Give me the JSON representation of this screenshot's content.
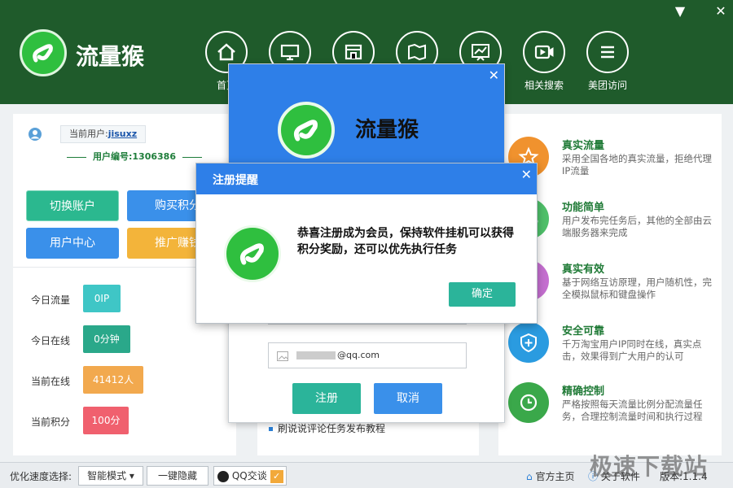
{
  "app": {
    "title": "流量猴"
  },
  "nav": [
    {
      "label": "首页",
      "icon": "home-icon"
    },
    {
      "label": "",
      "icon": "monitor-icon"
    },
    {
      "label": "",
      "icon": "store-icon"
    },
    {
      "label": "",
      "icon": "map-icon"
    },
    {
      "label": "",
      "icon": "chart-icon"
    },
    {
      "label": "相关搜索",
      "icon": "video-icon"
    },
    {
      "label": "美团访问",
      "icon": "menu-icon"
    }
  ],
  "user": {
    "label": "当前用户:",
    "name": "jisuxz",
    "id_text": "用户编号:1306386"
  },
  "buttons": {
    "switch_account": "切换账户",
    "buy_points": "购买积分",
    "user_center": "用户中心",
    "promote": "推广赚钱"
  },
  "stats": [
    {
      "label": "今日流量",
      "value": "0IP",
      "color": "#3fc6c6"
    },
    {
      "label": "今日在线",
      "value": "0分钟",
      "color": "#2aa88a"
    },
    {
      "label": "当前在线",
      "value": "41412人",
      "color": "#f2a94e"
    },
    {
      "label": "当前积分",
      "value": "100分",
      "color": "#f0606e"
    }
  ],
  "center": {
    "link": "刷说说评论任务发布教程"
  },
  "features": [
    {
      "title": "真实流量",
      "desc": "采用全国各地的真实流量，拒绝代理IP流量",
      "color": "#f0922e"
    },
    {
      "title": "功能简单",
      "desc": "用户发布完任务后，其他的全部由云端服务器来完成",
      "color": "#4fc06a"
    },
    {
      "title": "真实有效",
      "desc": "基于网络互访原理，用户随机性，完全模拟鼠标和键盘操作",
      "color": "#c56fd0"
    },
    {
      "title": "安全可靠",
      "desc": "千万淘宝用户IP同时在线，真实点击，效果得到广大用户的认可",
      "color": "#2a9be0"
    },
    {
      "title": "精确控制",
      "desc": "严格按照每天流量比例分配流量任务，合理控制流量时间和执行过程",
      "color": "#3aa84a"
    }
  ],
  "bottom": {
    "speed_label": "优化速度选择:",
    "mode": "智能模式",
    "hide": "一键隐藏",
    "qq": "QQ交谈",
    "home": "官方主页",
    "about": "关于软件",
    "version": "版本:1.1.4"
  },
  "register": {
    "title": "流量猴",
    "email": "@qq.com",
    "register_btn": "注册",
    "cancel_btn": "取消"
  },
  "modal": {
    "title": "注册提醒",
    "message": "恭喜注册成为会员，保持软件挂机可以获得积分奖励，还可以优先执行任务",
    "ok": "确定"
  },
  "watermark": "极速下载站"
}
